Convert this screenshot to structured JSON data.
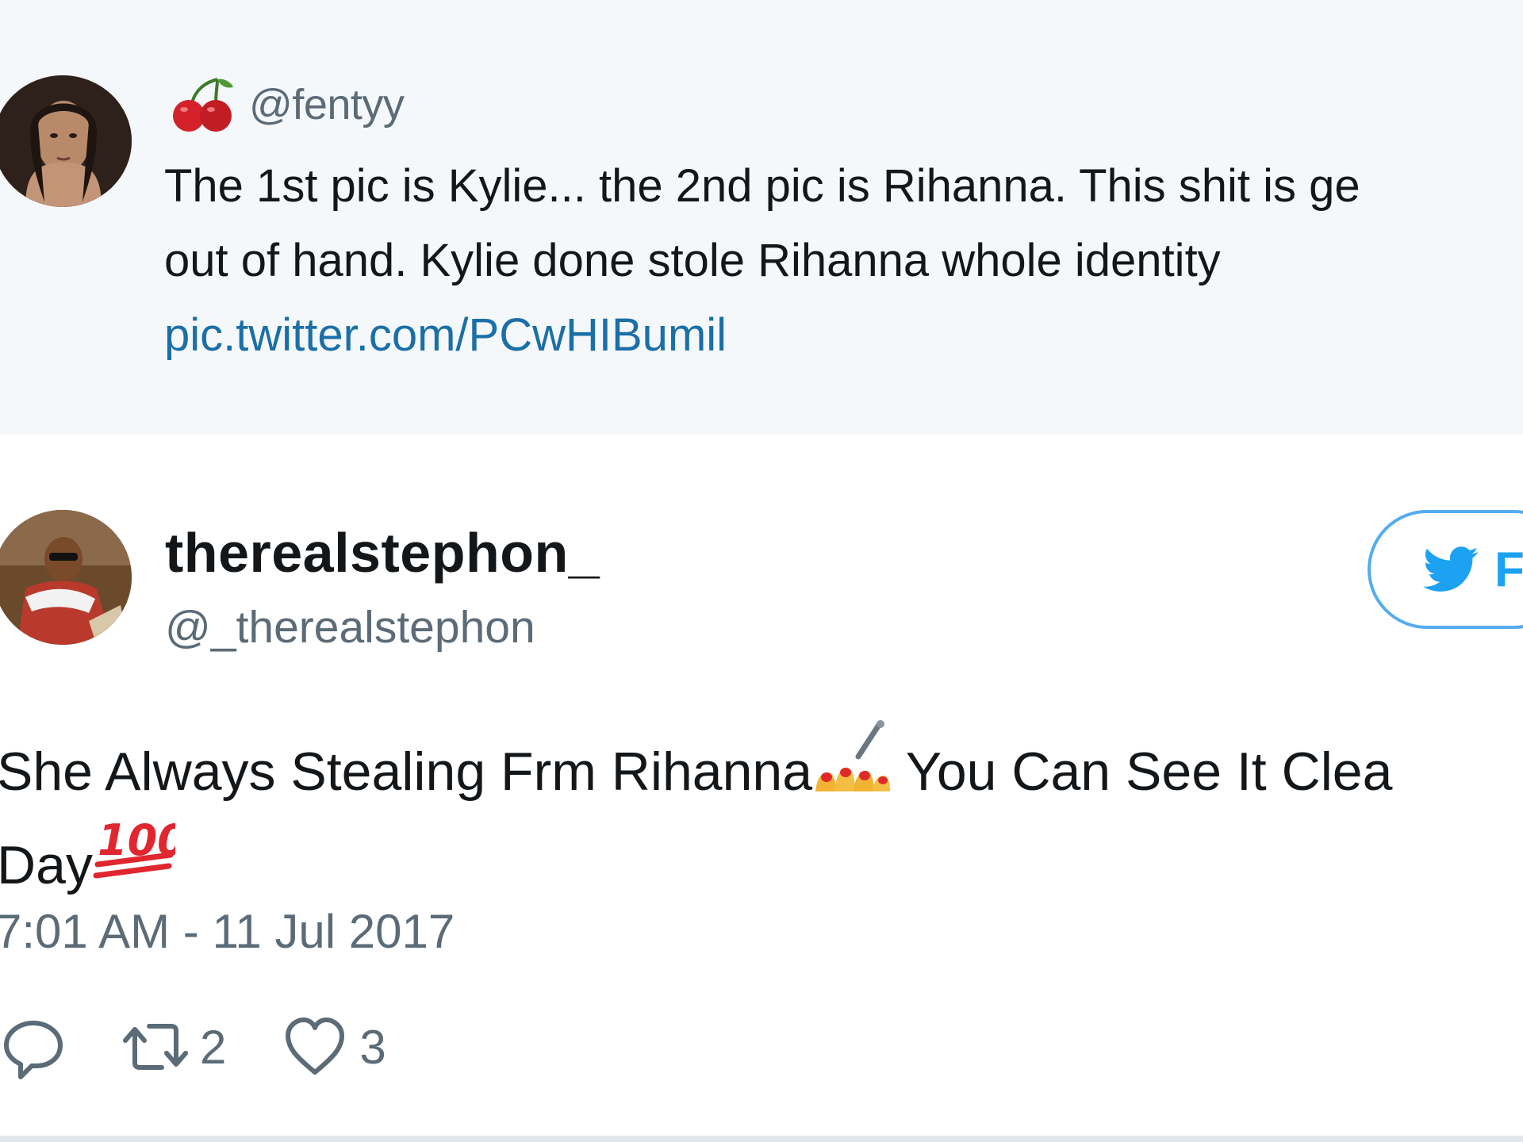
{
  "quoted_tweet": {
    "handle": "@fentyy",
    "text_line1": "The 1st pic is Kylie... the 2nd pic is Rihanna. This shit is ge",
    "text_line2": "out of hand. Kylie done stole Rihanna whole identity",
    "link": "pic.twitter.com/PCwHIBumil",
    "avatar_icon": "avatar-photo",
    "handle_emoji": "cherries-emoji"
  },
  "tweet": {
    "display_name": "therealstephon_",
    "handle": "@_therealstephon",
    "follow_label": "F",
    "body_line1_a": "She Always Stealing Frm Rihanna",
    "body_line1_b": " You Can See It Clea",
    "body_line2": "Day",
    "emojis": [
      "nail-polish-emoji",
      "hundred-points-emoji"
    ],
    "timestamp": "7:01 AM - 11 Jul 2017",
    "actions": {
      "reply_icon": "reply-icon",
      "retweet_icon": "retweet-icon",
      "retweet_count": "2",
      "like_icon": "heart-icon",
      "like_count": "3"
    }
  },
  "colors": {
    "quoted_background": "#f5f8fa",
    "link": "#1b6fa8",
    "secondary_text": "#5b6b77",
    "twitter_blue": "#1da1f2",
    "divider": "#e1e8ed"
  }
}
